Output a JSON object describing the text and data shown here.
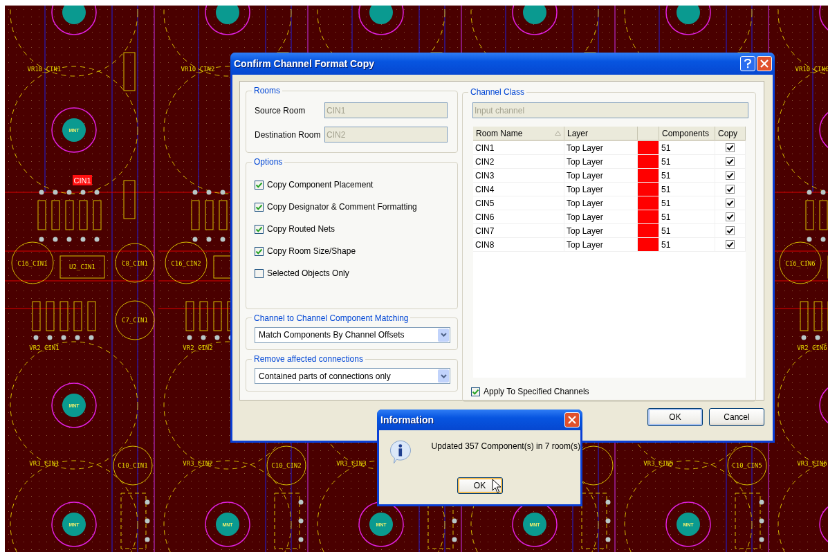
{
  "board": {
    "channels": [
      {
        "labels": [
          {
            "kind": "vr10",
            "text": "VR10_CIN1"
          },
          {
            "kind": "mnt_a",
            "text": "MNT"
          },
          {
            "kind": "room",
            "text": "CIN1"
          },
          {
            "kind": "c16",
            "text": "C16_CIN1"
          },
          {
            "kind": "u2",
            "text": "U2_CIN1"
          },
          {
            "kind": "c8",
            "text": "C8_CIN1"
          },
          {
            "kind": "c7",
            "text": "C7_CIN1"
          },
          {
            "kind": "vr2",
            "text": "VR2_CIN1"
          },
          {
            "kind": "mnt_b",
            "text": "MNT"
          },
          {
            "kind": "vr3",
            "text": "VR3_CIN1"
          },
          {
            "kind": "c10",
            "text": "C10_CIN1"
          },
          {
            "kind": "mnt_c",
            "text": "MNT"
          }
        ]
      },
      {
        "labels": [
          {
            "kind": "vr10",
            "text": "VR10_CIN2"
          },
          {
            "kind": "c16",
            "text": "C16_CIN2"
          },
          {
            "kind": "vr2",
            "text": "VR2_CIN2"
          },
          {
            "kind": "vr3",
            "text": "VR3_CIN2"
          },
          {
            "kind": "c10",
            "text": "C10_CIN2"
          },
          {
            "kind": "mnt_c",
            "text": "MNT"
          }
        ]
      },
      {
        "labels": [
          {
            "kind": "vr3",
            "text": "VR3_CIN3"
          },
          {
            "kind": "mnt_c",
            "text": "MNT"
          }
        ]
      },
      {
        "labels": [
          {
            "kind": "mnt_c",
            "text": "MNT"
          }
        ]
      },
      {
        "labels": [
          {
            "kind": "vr3",
            "text": "VR3_CIN5"
          },
          {
            "kind": "c10",
            "text": "C10_CIN5"
          },
          {
            "kind": "mnt_c",
            "text": "MNT"
          }
        ]
      },
      {
        "labels": [
          {
            "kind": "vr10",
            "text": "VR10_CIN6"
          },
          {
            "kind": "c16",
            "text": "C16_CIN6"
          },
          {
            "kind": "vr2",
            "text": "VR2_CIN6"
          },
          {
            "kind": "vr3",
            "text": "VR3_CIN6"
          }
        ]
      }
    ]
  },
  "dialog": {
    "title": "Confirm Channel Format Copy",
    "rooms": {
      "title": "Rooms",
      "fields": [
        {
          "label": "Source Room",
          "value": "CIN1",
          "disabled": true
        },
        {
          "label": "Destination Room",
          "value": "CIN2",
          "disabled": true
        }
      ]
    },
    "options": {
      "title": "Options",
      "items": [
        {
          "label": "Copy Component Placement",
          "checked": true
        },
        {
          "label": "Copy Designator & Comment Formatting",
          "checked": true
        },
        {
          "label": "Copy Routed Nets",
          "checked": true
        },
        {
          "label": "Copy Room Size/Shape",
          "checked": true
        },
        {
          "label": "Selected Objects Only",
          "checked": false
        }
      ]
    },
    "matching": {
      "title": "Channel to Channel Component Matching",
      "value": "Match Components By Channel Offsets"
    },
    "remove": {
      "title": "Remove affected connections",
      "value": "Contained parts of connections only"
    },
    "channel_class": {
      "title": "Channel Class",
      "value": "Input channel",
      "disabled": true,
      "columns": [
        {
          "label": "Room Name",
          "sorted": true
        },
        {
          "label": "Layer",
          "sorted": false
        },
        {
          "label": "Components",
          "sorted": false
        },
        {
          "label": "Copy",
          "sorted": false
        }
      ],
      "rows": [
        {
          "room": "CIN1",
          "layer": "Top Layer",
          "color": "#ff0000",
          "components": "51",
          "copy": true
        },
        {
          "room": "CIN2",
          "layer": "Top Layer",
          "color": "#ff0000",
          "components": "51",
          "copy": true
        },
        {
          "room": "CIN3",
          "layer": "Top Layer",
          "color": "#ff0000",
          "components": "51",
          "copy": true
        },
        {
          "room": "CIN4",
          "layer": "Top Layer",
          "color": "#ff0000",
          "components": "51",
          "copy": true
        },
        {
          "room": "CIN5",
          "layer": "Top Layer",
          "color": "#ff0000",
          "components": "51",
          "copy": true
        },
        {
          "room": "CIN6",
          "layer": "Top Layer",
          "color": "#ff0000",
          "components": "51",
          "copy": true
        },
        {
          "room": "CIN7",
          "layer": "Top Layer",
          "color": "#ff0000",
          "components": "51",
          "copy": true
        },
        {
          "room": "CIN8",
          "layer": "Top Layer",
          "color": "#ff0000",
          "components": "51",
          "copy": true
        }
      ],
      "apply": {
        "label": "Apply To Specified Channels",
        "checked": true
      }
    },
    "buttons": [
      "OK",
      "Cancel"
    ]
  },
  "info": {
    "title": "Information",
    "message": "Updated 357 Component(s) in 7 room(s)",
    "button": "OK"
  }
}
